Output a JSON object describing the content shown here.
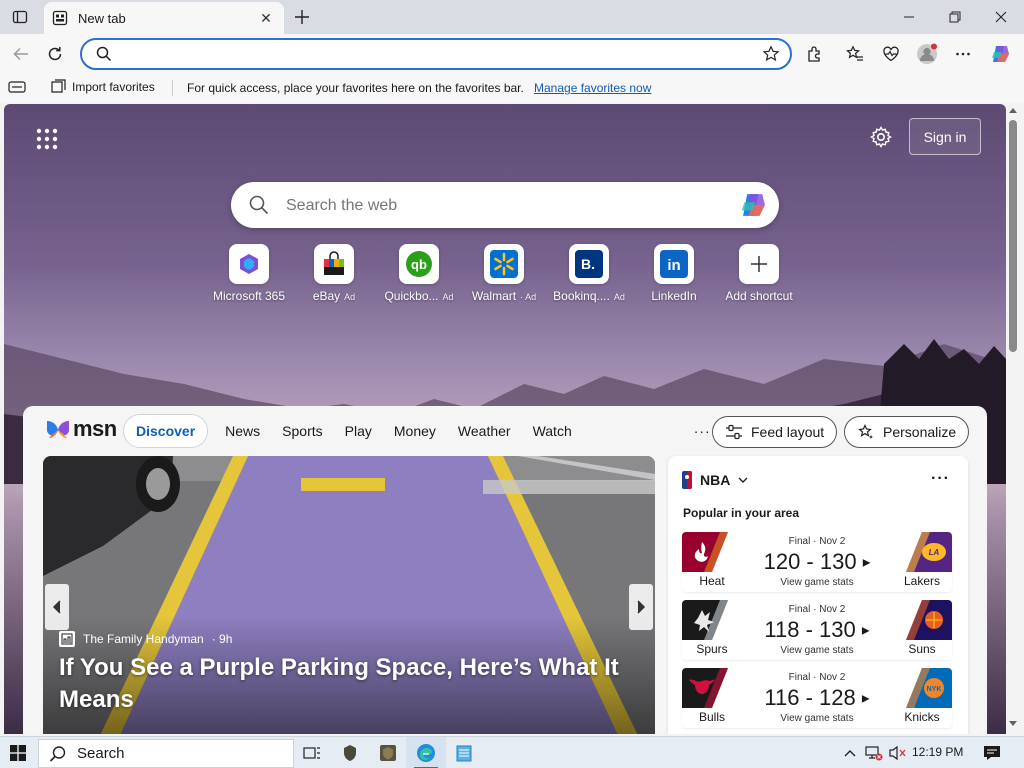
{
  "browser": {
    "tab": {
      "title": "New tab",
      "close_glyph": "✕"
    },
    "window_controls": {
      "minimize": "—",
      "restore": "❐",
      "close": "✕"
    }
  },
  "address_bar": {
    "value": "",
    "placeholder": ""
  },
  "favorites_bar": {
    "import_label": "Import favorites",
    "message": "For quick access, place your favorites here on the favorites bar.",
    "manage_link": "Manage favorites now"
  },
  "ntp": {
    "signin_label": "Sign in",
    "search_placeholder": "Search the web",
    "shortcuts": [
      {
        "label": "Microsoft 365",
        "ad": ""
      },
      {
        "label": "eBay",
        "ad": "Ad"
      },
      {
        "label": "Quickbo...",
        "ad": "Ad"
      },
      {
        "label": "Walmart",
        "ad": "· Ad"
      },
      {
        "label": "Bookinq....",
        "ad": "Ad"
      },
      {
        "label": "LinkedIn",
        "ad": ""
      },
      {
        "label": "Add shortcut",
        "ad": ""
      }
    ]
  },
  "feed": {
    "logo_text": "msn",
    "nav": [
      "Discover",
      "News",
      "Sports",
      "Play",
      "Money",
      "Weather",
      "Watch"
    ],
    "more": "···",
    "feed_layout_label": "Feed layout",
    "personalize_label": "Personalize",
    "hero": {
      "source": "The Family Handyman",
      "age": "· 9h",
      "headline": "If You See a Purple Parking Space, Here’s What It Means"
    },
    "nba": {
      "title": "NBA",
      "subtitle": "Popular in your area",
      "more": "···",
      "games": [
        {
          "status": "Final · Nov 2",
          "score": "120 - 130",
          "stats": "View game stats",
          "home": "Heat",
          "away": "Lakers",
          "home_color": "#98002e",
          "away_color": "#552583",
          "away_accent": "#fdb927"
        },
        {
          "status": "Final · Nov 2",
          "score": "118 - 130",
          "stats": "View game stats",
          "home": "Spurs",
          "away": "Suns",
          "home_color": "#1a1a1a",
          "away_color": "#1d1160",
          "away_accent": "#e56020"
        },
        {
          "status": "Final · Nov 2",
          "score": "116 - 128",
          "stats": "View game stats",
          "home": "Bulls",
          "away": "Knicks",
          "home_color": "#1a1a1a",
          "away_color": "#006bb6",
          "away_accent": "#f58426"
        }
      ]
    }
  },
  "taskbar": {
    "search_label": "Search",
    "time": "12:19 PM"
  },
  "colors": {
    "accent": "#2c6fd1",
    "link": "#0f5db5"
  }
}
